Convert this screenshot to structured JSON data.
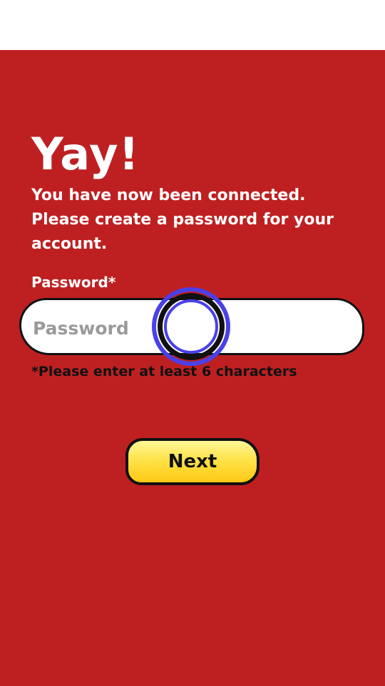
{
  "screen": {
    "title": "Yay!",
    "message": "You have now been connected. Please create a password for your account."
  },
  "password_field": {
    "label": "Password*",
    "placeholder": "Password",
    "value": "",
    "hint": "*Please enter at least 6 characters"
  },
  "actions": {
    "next_label": "Next"
  },
  "colors": {
    "background": "#be2022",
    "text": "#ffffff",
    "button": "#ffd83a",
    "touch_indicator": "#4a40e8"
  }
}
